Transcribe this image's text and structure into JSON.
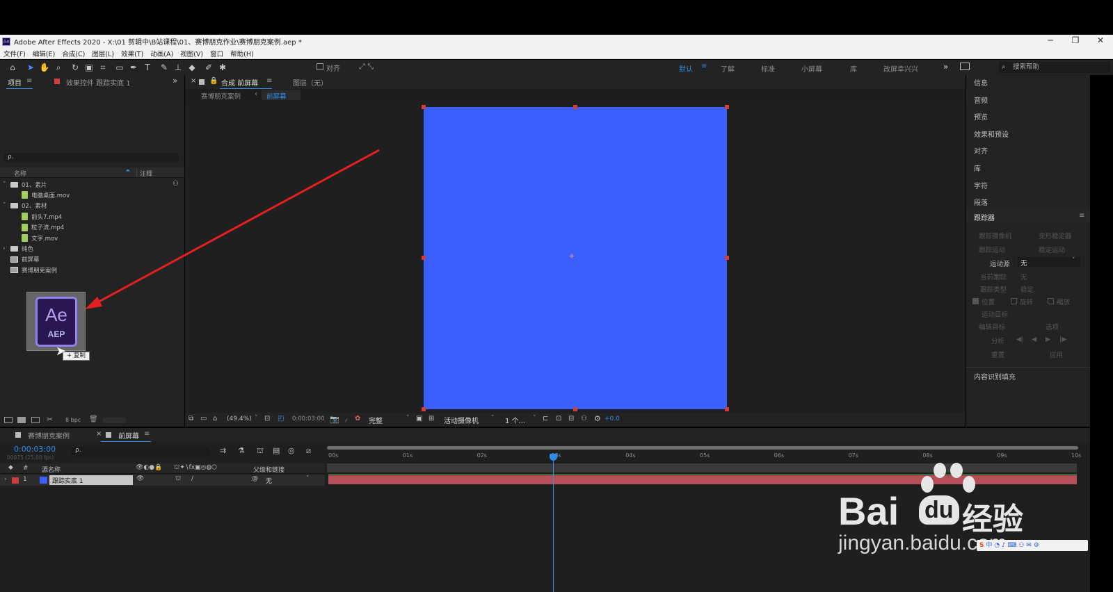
{
  "window": {
    "app_icon_label": "Ae",
    "title": "Adobe After Effects 2020 - X:\\01 剪辑中\\B站课程\\01、赛博朋克作业\\赛博朋克案例.aep *",
    "minimize": "─",
    "restore": "❐",
    "close": "✕"
  },
  "menu": [
    "文件(F)",
    "编辑(E)",
    "合成(C)",
    "图层(L)",
    "效果(T)",
    "动画(A)",
    "视图(V)",
    "窗口",
    "帮助(H)"
  ],
  "toolbar": {
    "snap_label": "对齐",
    "workspaces": [
      "默认",
      "了解",
      "标准",
      "小屏幕",
      "库",
      "改屏幸兴兴"
    ],
    "active_workspace": "默认",
    "more": "»",
    "help_search_placeholder": "搜索帮助"
  },
  "project_panel": {
    "tab_project": "项目",
    "tab_effects": "效果控件 跟踪实底 1",
    "more": "»",
    "search_icon": "ρ.",
    "col_name": "名称",
    "col_comment": "注释",
    "items": [
      {
        "label": "01、素片",
        "type": "folder",
        "indent": 0,
        "expander": "˅"
      },
      {
        "label": "电脑桌面.mov",
        "type": "file",
        "indent": 1,
        "expander": ""
      },
      {
        "label": "02、素材",
        "type": "folder",
        "indent": 0,
        "expander": "˅"
      },
      {
        "label": "前头7.mp4",
        "type": "file",
        "indent": 1,
        "expander": ""
      },
      {
        "label": "粒子流.mp4",
        "type": "file",
        "indent": 1,
        "expander": ""
      },
      {
        "label": "文字.mov",
        "type": "file",
        "indent": 1,
        "expander": ""
      },
      {
        "label": "纯色",
        "type": "folder",
        "indent": 0,
        "expander": "›"
      },
      {
        "label": "前屏幕",
        "type": "comp",
        "indent": 0,
        "expander": ""
      },
      {
        "label": "赛博朋克案例",
        "type": "comp",
        "indent": 0,
        "expander": ""
      }
    ],
    "bpc": "8 bpc",
    "drag_icon_top": "Ae",
    "drag_icon_bottom": "AEP",
    "drag_tooltip": "+ 复制"
  },
  "comp_panel": {
    "tab_comp": "合成 前屏幕",
    "tab_layer": "图层（无）",
    "breadcrumb_parent": "赛博朋克案例",
    "breadcrumb_child": "前屏幕",
    "solid_color": "#3b5eff",
    "zoom": "(49.4%)",
    "timecode": "0:00:03:00",
    "resolution": "完整",
    "camera": "活动摄像机",
    "views": "1 个...",
    "exposure": "+0.0"
  },
  "right_panel": {
    "items": [
      "信息",
      "音频",
      "预览",
      "效果和预设",
      "对齐",
      "库",
      "字符",
      "段落"
    ],
    "tracker_title": "跟踪器",
    "tracker_buttons": [
      "跟踪摄像机",
      "变形稳定器",
      "跟踪运动",
      "稳定运动"
    ],
    "motion_source_label": "运动源",
    "motion_source_value": "无",
    "current_track_label": "当前跟踪",
    "current_track_value": "无",
    "track_type_label": "跟踪类型",
    "track_type_value": "稳定",
    "checkbox_position": "位置",
    "checkbox_rotation": "旋转",
    "checkbox_scale": "缩放",
    "motion_target": "运动目标",
    "edit_target": "编辑目标",
    "options": "选项",
    "analyze": "分析",
    "analyze_controls": [
      "◀|",
      "◀",
      "▶",
      "|▶"
    ],
    "reset": "重置",
    "apply": "应用",
    "content_aware_fill": "内容识别填充"
  },
  "timeline": {
    "tabs": [
      "赛博朋克案例",
      "前屏幕"
    ],
    "timecode": "0:00:03:00",
    "fps": "00075 (25.00 fps)",
    "col_source_name": "源名称",
    "col_parent": "父级和链接",
    "layer_number": "1",
    "layer_name": "跟踪实底 1",
    "layer_parent": "无",
    "ruler_ticks": [
      "00s",
      "01s",
      "02s",
      "03s",
      "04s",
      "05s",
      "06s",
      "07s",
      "08s",
      "09s",
      "10s"
    ],
    "layer_bar_color": "#b54f57",
    "layer_label_color": "#cf3d3d"
  },
  "watermark": {
    "brand": "Bai",
    "brand_mid": "du",
    "brand_cn": "经验",
    "url": "jingyan.baidu.com"
  }
}
